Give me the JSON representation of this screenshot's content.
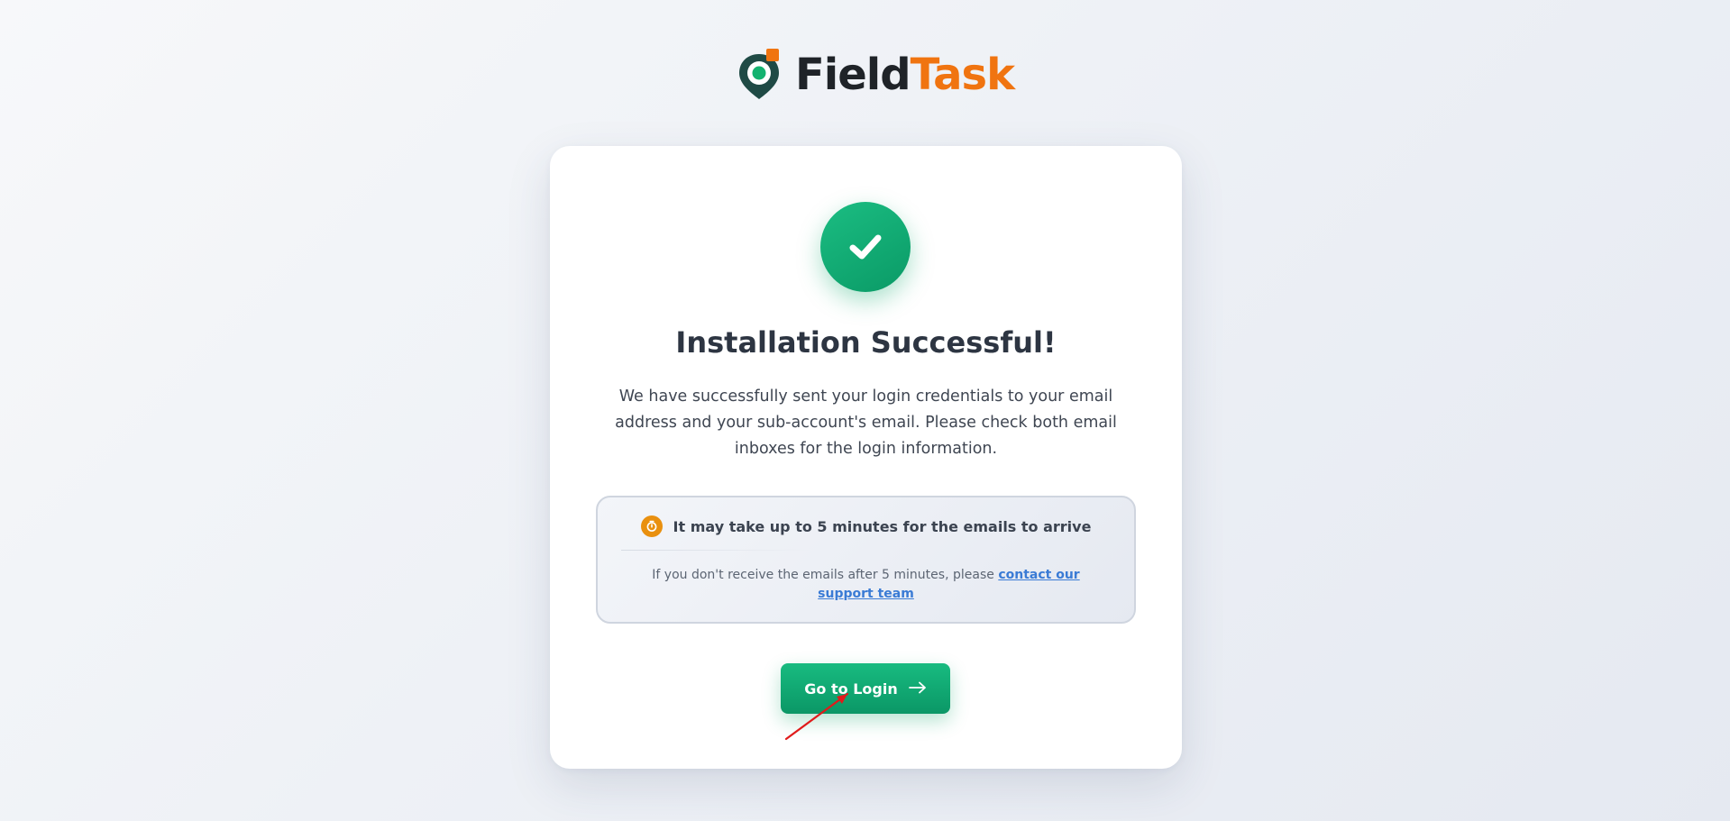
{
  "brand": {
    "name_part1": "Field",
    "name_part2": "Task",
    "colors": {
      "dark": "#1f2328",
      "orange": "#f07410",
      "green": "#10aa72"
    }
  },
  "success": {
    "icon": "check-icon",
    "title": "Installation Successful!",
    "message": "We have successfully sent your login credentials to your email address and your sub-account's email. Please check both email inboxes for the login information."
  },
  "notice": {
    "icon": "clock-icon",
    "heading": "It may take up to 5 minutes for the emails to arrive",
    "sub_text": "If you don't receive the emails after 5 minutes, please ",
    "link_text": "contact our support team"
  },
  "actions": {
    "login_label": "Go to Login",
    "login_icon": "arrow-right-icon"
  }
}
